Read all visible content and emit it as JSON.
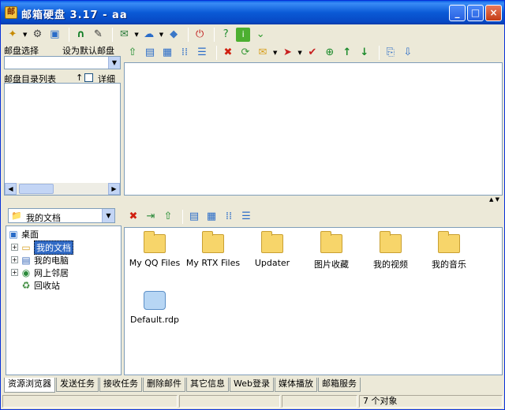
{
  "window": {
    "title": "邮箱硬盘 3.17 - aa",
    "minimize": "_",
    "maximize": "□",
    "close": "×"
  },
  "toolbar_top": {
    "icons": [
      "dropdown-wand-icon",
      "gear-icon",
      "window-icon",
      "horseshoe-icon",
      "pin-icon",
      "mail-check-icon",
      "network-icon",
      "diamond-icon",
      "power-icon",
      "help-icon",
      "info-icon",
      "chevron-down-icon"
    ]
  },
  "left_top": {
    "mailbox_label": "邮盘选择",
    "set_default_label": "设为默认邮盘",
    "mailbox_value": "",
    "dirlist_label": "邮盘目录列表",
    "sort_arrow": "↑",
    "detail_label": "详细"
  },
  "folder_combo": {
    "value": "我的文档"
  },
  "tree": {
    "root": "桌面",
    "items": [
      {
        "label": "我的文档",
        "icon": "folder-icon",
        "expandable": true,
        "selected": true
      },
      {
        "label": "我的电脑",
        "icon": "computer-icon",
        "expandable": true,
        "selected": false
      },
      {
        "label": "网上邻居",
        "icon": "network-icon",
        "expandable": true,
        "selected": false
      },
      {
        "label": "回收站",
        "icon": "recycle-bin-icon",
        "expandable": false,
        "selected": false
      }
    ]
  },
  "files": [
    {
      "name": "My QQ Files",
      "type": "folder"
    },
    {
      "name": "My RTX Files",
      "type": "folder"
    },
    {
      "name": "Updater",
      "type": "folder"
    },
    {
      "name": "图片收藏",
      "type": "folder"
    },
    {
      "name": "我的视频",
      "type": "folder"
    },
    {
      "name": "我的音乐",
      "type": "folder"
    },
    {
      "name": "Default.rdp",
      "type": "file"
    }
  ],
  "tabs": [
    "资源浏览器",
    "发送任务",
    "接收任务",
    "删除邮件",
    "其它信息",
    "Web登录",
    "媒体播放",
    "邮箱服务"
  ],
  "active_tab": 0,
  "status": {
    "count": "7 个对象"
  },
  "colors": {
    "titlebar": "#0a5ad6",
    "selection": "#316ac5",
    "window_bg": "#ece9d8"
  }
}
